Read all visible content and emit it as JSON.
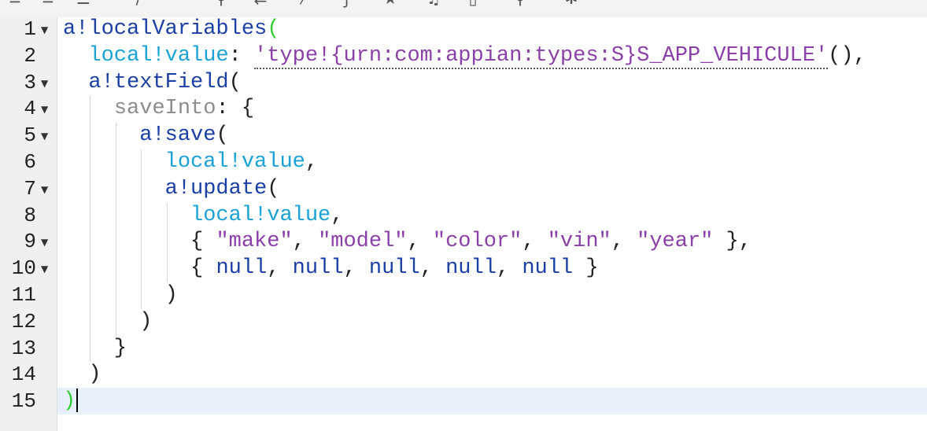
{
  "editor": {
    "lines": [
      {
        "number": "1",
        "foldable": true,
        "tokens": [
          {
            "text": "a!localVariables",
            "kind": "fn"
          },
          {
            "text": "(",
            "kind": "green"
          }
        ]
      },
      {
        "number": "2",
        "foldable": false,
        "tokens": [
          {
            "text": "  ",
            "kind": "punc"
          },
          {
            "text": "local!value",
            "kind": "local"
          },
          {
            "text": ": ",
            "kind": "punc"
          },
          {
            "text": "'type!{urn:com:appian:types:S}S_APP_VEHICULE'",
            "kind": "str",
            "dotted": true
          },
          {
            "text": "(),",
            "kind": "punc"
          }
        ]
      },
      {
        "number": "3",
        "foldable": true,
        "tokens": [
          {
            "text": "  ",
            "kind": "punc"
          },
          {
            "text": "a!textField",
            "kind": "fn"
          },
          {
            "text": "(",
            "kind": "punc"
          }
        ]
      },
      {
        "number": "4",
        "foldable": true,
        "tokens": [
          {
            "text": "    ",
            "kind": "punc"
          },
          {
            "text": "saveInto",
            "kind": "grey"
          },
          {
            "text": ": {",
            "kind": "punc"
          }
        ]
      },
      {
        "number": "5",
        "foldable": true,
        "tokens": [
          {
            "text": "      ",
            "kind": "punc"
          },
          {
            "text": "a!save",
            "kind": "fn"
          },
          {
            "text": "(",
            "kind": "punc"
          }
        ]
      },
      {
        "number": "6",
        "foldable": false,
        "tokens": [
          {
            "text": "        ",
            "kind": "punc"
          },
          {
            "text": "local!value",
            "kind": "local"
          },
          {
            "text": ",",
            "kind": "punc"
          }
        ]
      },
      {
        "number": "7",
        "foldable": true,
        "tokens": [
          {
            "text": "        ",
            "kind": "punc"
          },
          {
            "text": "a!update",
            "kind": "fn"
          },
          {
            "text": "(",
            "kind": "punc"
          }
        ]
      },
      {
        "number": "8",
        "foldable": false,
        "tokens": [
          {
            "text": "          ",
            "kind": "punc"
          },
          {
            "text": "local!value",
            "kind": "local"
          },
          {
            "text": ",",
            "kind": "punc"
          }
        ]
      },
      {
        "number": "9",
        "foldable": true,
        "tokens": [
          {
            "text": "          { ",
            "kind": "punc"
          },
          {
            "text": "\"make\"",
            "kind": "str"
          },
          {
            "text": ", ",
            "kind": "punc"
          },
          {
            "text": "\"model\"",
            "kind": "str"
          },
          {
            "text": ", ",
            "kind": "punc"
          },
          {
            "text": "\"color\"",
            "kind": "str"
          },
          {
            "text": ", ",
            "kind": "punc"
          },
          {
            "text": "\"vin\"",
            "kind": "str"
          },
          {
            "text": ", ",
            "kind": "punc"
          },
          {
            "text": "\"year\"",
            "kind": "str"
          },
          {
            "text": " },",
            "kind": "punc"
          }
        ]
      },
      {
        "number": "10",
        "foldable": true,
        "tokens": [
          {
            "text": "          { ",
            "kind": "punc"
          },
          {
            "text": "null",
            "kind": "null"
          },
          {
            "text": ", ",
            "kind": "punc"
          },
          {
            "text": "null",
            "kind": "null"
          },
          {
            "text": ", ",
            "kind": "punc"
          },
          {
            "text": "null",
            "kind": "null"
          },
          {
            "text": ", ",
            "kind": "punc"
          },
          {
            "text": "null",
            "kind": "null"
          },
          {
            "text": ", ",
            "kind": "punc"
          },
          {
            "text": "null",
            "kind": "null"
          },
          {
            "text": " }",
            "kind": "punc"
          }
        ]
      },
      {
        "number": "11",
        "foldable": false,
        "tokens": [
          {
            "text": "        )",
            "kind": "punc"
          }
        ]
      },
      {
        "number": "12",
        "foldable": false,
        "tokens": [
          {
            "text": "      )",
            "kind": "punc"
          }
        ]
      },
      {
        "number": "13",
        "foldable": false,
        "tokens": [
          {
            "text": "    }",
            "kind": "punc"
          }
        ]
      },
      {
        "number": "14",
        "foldable": false,
        "tokens": [
          {
            "text": "  )",
            "kind": "punc"
          }
        ]
      },
      {
        "number": "15",
        "foldable": false,
        "tokens": [
          {
            "text": ")",
            "kind": "green"
          }
        ]
      }
    ],
    "active_line": "15",
    "colors": {
      "function": "#1a3fa5",
      "local_variable": "#1aa2d6",
      "parameter": "#8d8d8d",
      "string": "#8b3fa8",
      "null_keyword": "#1a3fa5",
      "matched_bracket": "#33cc33",
      "active_line_bg": "#e8f1fb",
      "gutter_bg": "#f0f0f0"
    },
    "fold_marker": "▼"
  },
  "toolbar": {
    "icons": [
      "outdent-icon",
      "indent-icon",
      "list-icon",
      "comment-icon",
      "search-icon",
      "replace-icon",
      "format-icon",
      "function-icon",
      "star-icon",
      "music-icon",
      "copy-icon",
      "zoom-icon",
      "settings-icon"
    ]
  }
}
